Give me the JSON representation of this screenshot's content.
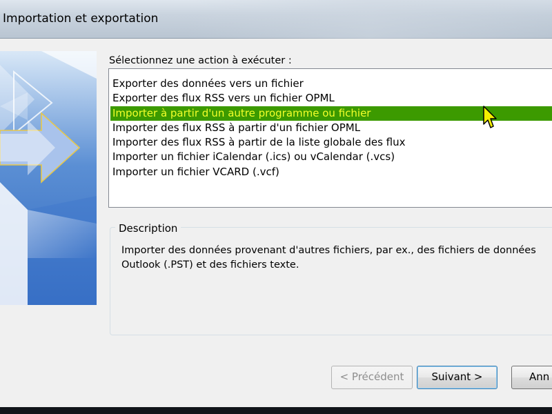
{
  "window": {
    "title": "Importation et exportation"
  },
  "main": {
    "action_label": "Sélectionnez une action à exécuter :",
    "actions": [
      "Exporter des données vers un fichier",
      "Exporter des flux RSS vers un fichier OPML",
      "Importer à partir d'un autre programme ou fichier",
      "Importer des flux RSS à partir d'un fichier OPML",
      "Importer des flux RSS à partir de la liste globale des flux",
      "Importer un fichier iCalendar (.ics) ou vCalendar (.vcs)",
      "Importer un fichier VCARD (.vcf)"
    ],
    "selected_index": 2,
    "selection_colors": {
      "background": "#3c9a00",
      "text": "#f2ff2a"
    },
    "description": {
      "legend": "Description",
      "text": "Importer des données provenant d'autres fichiers, par ex., des fichiers de données Outlook (.PST) et des fichiers texte."
    }
  },
  "buttons": {
    "previous": "< Précédent",
    "next": "Suivant >",
    "cancel": "Ann"
  },
  "icons": {
    "pointer": "mouse-pointer-icon",
    "wizard_art": "import-export-wizard-graphic"
  }
}
